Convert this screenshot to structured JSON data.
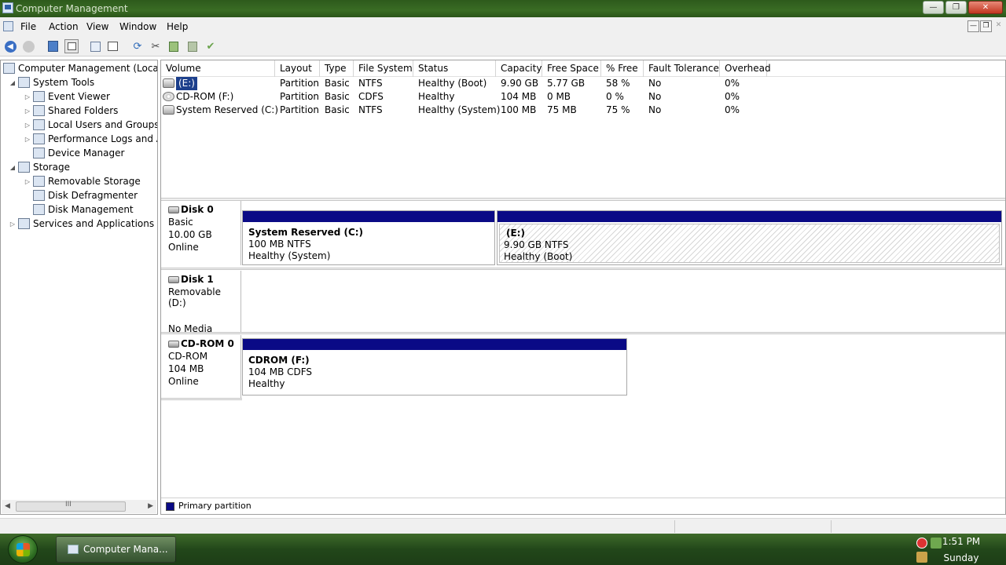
{
  "window": {
    "title": "Computer Management",
    "min": "—",
    "max": "❐",
    "close": "✕"
  },
  "menu": [
    "File",
    "Action",
    "View",
    "Window",
    "Help"
  ],
  "mdi": {
    "min": "—",
    "restore": "❐",
    "close": "✕"
  },
  "tree": {
    "root": "Computer Management (Local)",
    "items": [
      {
        "label": "System Tools",
        "level": 1,
        "exp": "◢"
      },
      {
        "label": "Event Viewer",
        "level": 2,
        "exp": "▷"
      },
      {
        "label": "Shared Folders",
        "level": 2,
        "exp": "▷"
      },
      {
        "label": "Local Users and Groups",
        "level": 2,
        "exp": "▷"
      },
      {
        "label": "Performance Logs and A",
        "level": 2,
        "exp": "▷"
      },
      {
        "label": "Device Manager",
        "level": 2,
        "exp": ""
      },
      {
        "label": "Storage",
        "level": 1,
        "exp": "◢"
      },
      {
        "label": "Removable Storage",
        "level": 2,
        "exp": "▷"
      },
      {
        "label": "Disk Defragmenter",
        "level": 2,
        "exp": ""
      },
      {
        "label": "Disk Management",
        "level": 2,
        "exp": ""
      },
      {
        "label": "Services and Applications",
        "level": 1,
        "exp": "▷"
      }
    ],
    "scroll_mid": "III"
  },
  "volumes": {
    "columns": [
      "Volume",
      "Layout",
      "Type",
      "File System",
      "Status",
      "Capacity",
      "Free Space",
      "% Free",
      "Fault Tolerance",
      "Overhead"
    ],
    "rows": [
      {
        "icon": "disk-icon",
        "cells": [
          "(E:)",
          "Partition",
          "Basic",
          "NTFS",
          "Healthy (Boot)",
          "9.90 GB",
          "5.77 GB",
          "58 %",
          "No",
          "0%"
        ],
        "selected": true
      },
      {
        "icon": "cdrom-icon",
        "cells": [
          "CD-ROM (F:)",
          "Partition",
          "Basic",
          "CDFS",
          "Healthy",
          "104 MB",
          "0 MB",
          "0 %",
          "No",
          "0%"
        ]
      },
      {
        "icon": "disk-icon",
        "cells": [
          "System Reserved (C:)",
          "Partition",
          "Basic",
          "NTFS",
          "Healthy (System)",
          "100 MB",
          "75 MB",
          "75 %",
          "No",
          "0%"
        ]
      }
    ]
  },
  "disks": [
    {
      "name": "Disk 0",
      "lines": [
        "Basic",
        "10.00 GB",
        "Online"
      ],
      "partitions": [
        {
          "name": "System Reserved  (C:)",
          "size": "100 MB NTFS",
          "status": "Healthy (System)"
        },
        {
          "name": "(E:)",
          "size": "9.90 GB NTFS",
          "status": "Healthy (Boot)"
        }
      ]
    },
    {
      "name": "Disk 1",
      "lines": [
        "Removable (D:)",
        "",
        "No Media"
      ],
      "partitions": []
    },
    {
      "name": "CD-ROM 0",
      "lines": [
        "CD-ROM",
        "104 MB",
        "Online"
      ],
      "partitions": [
        {
          "name": "CDROM  (F:)",
          "size": "104 MB CDFS",
          "status": "Healthy"
        }
      ]
    }
  ],
  "legend": {
    "label": "Primary partition",
    "color": "#0a0a86"
  },
  "taskbar": {
    "app": "Computer Mana...",
    "time": "1:51 PM",
    "day": "Sunday"
  }
}
